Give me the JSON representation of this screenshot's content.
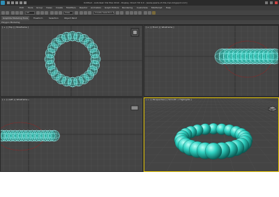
{
  "window": {
    "title": "Untitled - Autodesk 3ds Max 2010 - Display: Direct 3D 9.0 - [www.pearls-of-3ds-max.blogspot.com]"
  },
  "menu": {
    "items": [
      "Edit",
      "Tools",
      "Group",
      "Views",
      "Create",
      "Modifiers",
      "Reactor",
      "Animation",
      "Graph Editors",
      "Rendering",
      "Customize",
      "MAXScript",
      "Help"
    ]
  },
  "toolbar": {
    "selection_filter": "All",
    "view_dropdown": "View",
    "named_selection": "Create Selection Set"
  },
  "ribbon": {
    "tabs": [
      "Graphite Modeling Tools",
      "Freeform",
      "Selection",
      "Object Paint"
    ],
    "active_tab": "Graphite Modeling Tools",
    "sub_label": "Polygon Modeling"
  },
  "viewports": {
    "top": {
      "label": "[ + ] [ Top ] [ Wireframe ]"
    },
    "front": {
      "label": "[ + ] [ Front ] [ Wireframe ]"
    },
    "left": {
      "label": "[ + ] [ Left ] [ Wireframe ]"
    },
    "perspective": {
      "label": "[ + ] [ Perspective ] [ Smooth + Highlights ]"
    }
  },
  "colors": {
    "object": "#27d0c0",
    "wire": "#a8ffff",
    "grid": "#4f4f4f",
    "grid_axis": "#222222",
    "path_circle": "#b01818",
    "active_border": "#e3c300"
  },
  "icons": {
    "app": "3ds-max-logo-icon",
    "viewcube": "viewcube-icon",
    "steering": "steering-wheel-icon"
  }
}
